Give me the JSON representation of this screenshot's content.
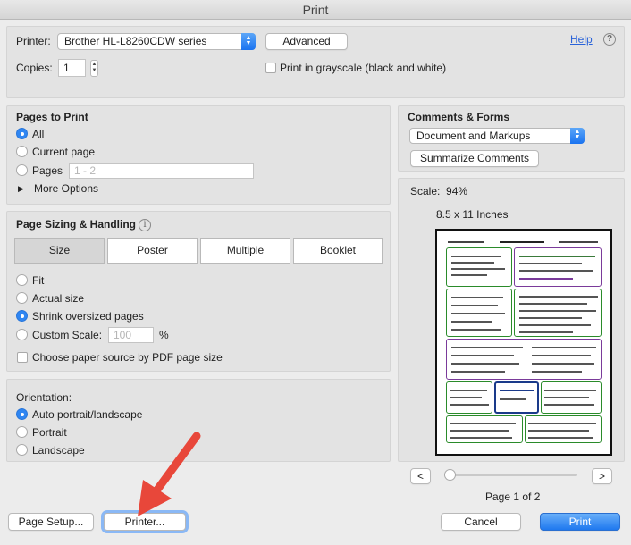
{
  "window": {
    "title": "Print"
  },
  "printer": {
    "label": "Printer:",
    "selected": "Brother HL-L8260CDW series",
    "advanced_label": "Advanced",
    "help_label": "Help",
    "copies_label": "Copies:",
    "copies_value": "1",
    "grayscale_label": "Print in grayscale (black and white)"
  },
  "pages_to_print": {
    "heading": "Pages to Print",
    "all_label": "All",
    "current_label": "Current page",
    "pages_label": "Pages",
    "pages_placeholder": "1 - 2",
    "more_options_label": "More Options",
    "selected": "All"
  },
  "sizing": {
    "heading": "Page Sizing & Handling",
    "tabs": [
      "Size",
      "Poster",
      "Multiple",
      "Booklet"
    ],
    "selected_tab": "Size",
    "fit_label": "Fit",
    "actual_label": "Actual size",
    "shrink_label": "Shrink oversized pages",
    "custom_label": "Custom Scale:",
    "custom_value": "100",
    "percent_label": "%",
    "paper_source_label": "Choose paper source by PDF page size",
    "selected": "Shrink oversized pages"
  },
  "orientation": {
    "heading": "Orientation:",
    "auto_label": "Auto portrait/landscape",
    "portrait_label": "Portrait",
    "landscape_label": "Landscape",
    "selected": "Auto portrait/landscape"
  },
  "comments": {
    "heading": "Comments & Forms",
    "selected": "Document and Markups",
    "summarize_label": "Summarize Comments"
  },
  "preview": {
    "scale_text": "Scale:  94%",
    "paper_size": "8.5 x 11 Inches",
    "page_text": "Page 1 of 2",
    "prev_label": "<",
    "next_label": ">",
    "slider_position": 0
  },
  "footer": {
    "page_setup_label": "Page Setup...",
    "printer_label": "Printer...",
    "cancel_label": "Cancel",
    "print_label": "Print"
  },
  "colors": {
    "accent": "#2f86f2",
    "annotation_arrow": "#e8473a"
  }
}
